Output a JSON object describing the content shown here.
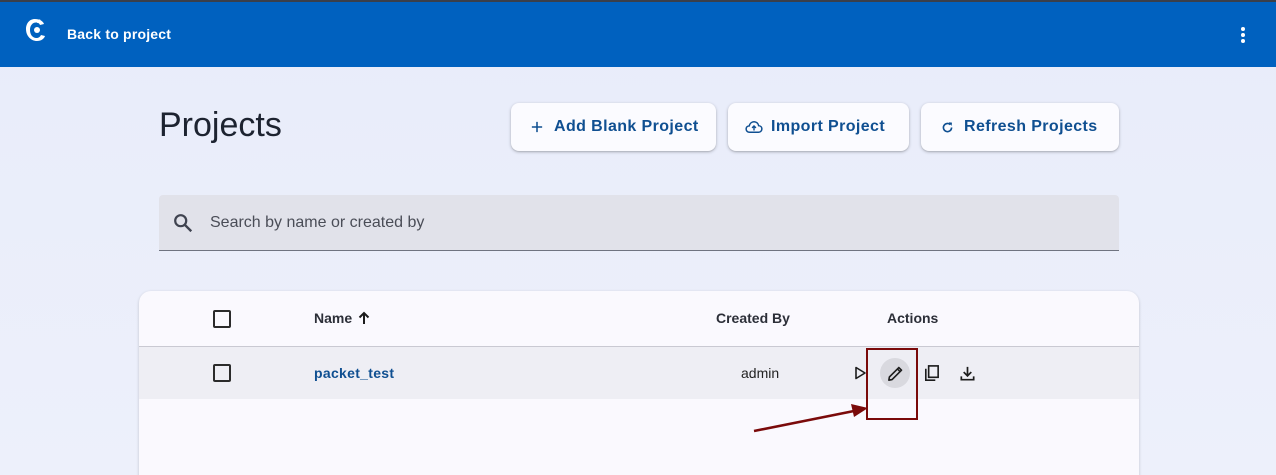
{
  "appbar": {
    "back_label": "Back to project",
    "logo_icon": "app-logo-icon",
    "menu_icon": "more-vert-icon",
    "bg_color": "#0061bf"
  },
  "page": {
    "title": "Projects"
  },
  "buttons": {
    "add": {
      "label": "Add Blank Project",
      "icon": "plus-icon"
    },
    "import": {
      "label": "Import Project",
      "icon": "cloud-upload-icon"
    },
    "refresh": {
      "label": "Refresh Projects",
      "icon": "refresh-icon"
    }
  },
  "search": {
    "placeholder": "Search by name or created by",
    "value": "",
    "icon": "search-icon"
  },
  "table": {
    "columns": {
      "name": "Name",
      "created_by": "Created By",
      "actions": "Actions"
    },
    "sort": {
      "column": "Name",
      "direction": "ascending",
      "icon": "arrow-up-icon"
    },
    "rows": [
      {
        "name": "packet_test",
        "created_by": "admin",
        "selected": false,
        "actions": [
          "play-icon",
          "edit-icon",
          "copy-icon",
          "download-icon"
        ]
      }
    ]
  },
  "colors": {
    "accent": "#0f4f91",
    "annotation": "#7a0a0a"
  }
}
